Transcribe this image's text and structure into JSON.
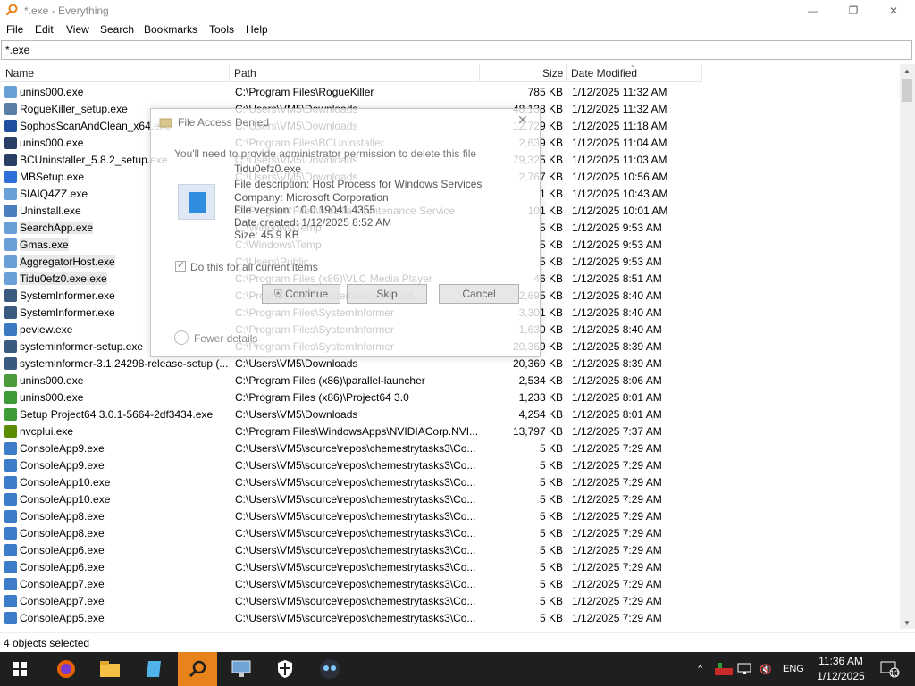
{
  "window": {
    "title": "*.exe - Everything",
    "minimize_label": "—",
    "maximize_label": "❐",
    "close_label": "✕"
  },
  "menu": [
    "File",
    "Edit",
    "View",
    "Search",
    "Bookmarks",
    "Tools",
    "Help"
  ],
  "search": {
    "value": "*.exe"
  },
  "columns": {
    "name": "Name",
    "path": "Path",
    "size": "Size",
    "date": "Date Modified"
  },
  "rows": [
    {
      "name": "unins000.exe",
      "path": "C:\\Program Files\\RogueKiller",
      "size": "785 KB",
      "date": "1/12/2025 11:32 AM",
      "icon": "generic-exe-icon",
      "color": "#6aa0d8"
    },
    {
      "name": "RogueKiller_setup.exe",
      "path": "C:\\Users\\VM5\\Downloads",
      "size": "48,138 KB",
      "date": "1/12/2025 11:32 AM",
      "icon": "roguekiller-icon",
      "color": "#5a7fa6"
    },
    {
      "name": "SophosScanAndClean_x64.exe",
      "path": "C:\\Users\\VM5\\Downloads",
      "size": "12,729 KB",
      "date": "1/12/2025 11:18 AM",
      "icon": "sophos-icon",
      "color": "#1f4e9e"
    },
    {
      "name": "unins000.exe",
      "path": "C:\\Program Files\\BCUninstaller",
      "size": "2,639 KB",
      "date": "1/12/2025 11:04 AM",
      "icon": "bcuninstaller-icon",
      "color": "#2a3f66"
    },
    {
      "name": "BCUninstaller_5.8.2_setup.exe",
      "path": "C:\\Users\\VM5\\Downloads",
      "size": "79,325 KB",
      "date": "1/12/2025 11:03 AM",
      "icon": "bcuninstaller-icon",
      "color": "#2a3f66"
    },
    {
      "name": "MBSetup.exe",
      "path": "C:\\Users\\VM5\\Downloads",
      "size": "2,767 KB",
      "date": "1/12/2025 10:56 AM",
      "icon": "malwarebytes-icon",
      "color": "#2d6fd6"
    },
    {
      "name": "SIAIQ4ZZ.exe",
      "path": "",
      "size": "1 KB",
      "date": "1/12/2025 10:43 AM",
      "icon": "generic-exe-icon",
      "color": "#6aa0d8"
    },
    {
      "name": "Uninstall.exe",
      "path": "C:\\Program Files\\Mozilla Maintenance Service",
      "size": "101 KB",
      "date": "1/12/2025 10:01 AM",
      "icon": "uninstall-icon",
      "color": "#4b7fbf"
    },
    {
      "name": "SearchApp.exe",
      "path": "C:\\Windows\\Temp",
      "size": "5 KB",
      "date": "1/12/2025 9:53 AM",
      "icon": "generic-exe-icon",
      "color": "#6aa0d8",
      "selected": true
    },
    {
      "name": "Gmas.exe",
      "path": "C:\\Windows\\Temp",
      "size": "5 KB",
      "date": "1/12/2025 9:53 AM",
      "icon": "generic-exe-icon",
      "color": "#6aa0d8",
      "selected": true
    },
    {
      "name": "AggregatorHost.exe",
      "path": "C:\\Users\\Public",
      "size": "5 KB",
      "date": "1/12/2025 9:53 AM",
      "icon": "generic-exe-icon",
      "color": "#6aa0d8",
      "selected": true
    },
    {
      "name": "Tidu0efz0.exe.exe",
      "path": "C:\\Program Files (x86)\\VLC Media Player",
      "size": "46 KB",
      "date": "1/12/2025 8:51 AM",
      "icon": "generic-exe-icon",
      "color": "#6aa0d8",
      "selected": true
    },
    {
      "name": "SystemInformer.exe",
      "path": "C:\\Program Files\\SystemInformer\\x86",
      "size": "2,695 KB",
      "date": "1/12/2025 8:40 AM",
      "icon": "systeminformer-icon",
      "color": "#3b5a80"
    },
    {
      "name": "SystemInformer.exe",
      "path": "C:\\Program Files\\SystemInformer",
      "size": "3,301 KB",
      "date": "1/12/2025 8:40 AM",
      "icon": "systeminformer-icon",
      "color": "#3b5a80"
    },
    {
      "name": "peview.exe",
      "path": "C:\\Program Files\\SystemInformer",
      "size": "1,630 KB",
      "date": "1/12/2025 8:40 AM",
      "icon": "peview-icon",
      "color": "#3a78c2"
    },
    {
      "name": "systeminformer-setup.exe",
      "path": "C:\\Program Files\\SystemInformer",
      "size": "20,369 KB",
      "date": "1/12/2025 8:39 AM",
      "icon": "systeminformer-icon",
      "color": "#3b5a80"
    },
    {
      "name": "systeminformer-3.1.24298-release-setup (...",
      "path": "C:\\Users\\VM5\\Downloads",
      "size": "20,369 KB",
      "date": "1/12/2025 8:39 AM",
      "icon": "systeminformer-icon",
      "color": "#3b5a80"
    },
    {
      "name": "unins000.exe",
      "path": "C:\\Program Files (x86)\\parallel-launcher",
      "size": "2,534 KB",
      "date": "1/12/2025 8:06 AM",
      "icon": "parallel-launcher-icon",
      "color": "#4c9a3a"
    },
    {
      "name": "unins000.exe",
      "path": "C:\\Program Files (x86)\\Project64 3.0",
      "size": "1,233 KB",
      "date": "1/12/2025 8:01 AM",
      "icon": "project64-icon",
      "color": "#3e9b35"
    },
    {
      "name": "Setup Project64 3.0.1-5664-2df3434.exe",
      "path": "C:\\Users\\VM5\\Downloads",
      "size": "4,254 KB",
      "date": "1/12/2025 8:01 AM",
      "icon": "project64-icon",
      "color": "#3e9b35"
    },
    {
      "name": "nvcplui.exe",
      "path": "C:\\Program Files\\WindowsApps\\NVIDIACorp.NVI...",
      "size": "13,797 KB",
      "date": "1/12/2025 7:37 AM",
      "icon": "nvidia-icon",
      "color": "#5c8c00"
    },
    {
      "name": "ConsoleApp9.exe",
      "path": "C:\\Users\\VM5\\source\\repos\\chemestrytasks3\\Co...",
      "size": "5 KB",
      "date": "1/12/2025 7:29 AM",
      "icon": "console-app-icon",
      "color": "#3d7cc9"
    },
    {
      "name": "ConsoleApp9.exe",
      "path": "C:\\Users\\VM5\\source\\repos\\chemestrytasks3\\Co...",
      "size": "5 KB",
      "date": "1/12/2025 7:29 AM",
      "icon": "console-app-icon",
      "color": "#3d7cc9"
    },
    {
      "name": "ConsoleApp10.exe",
      "path": "C:\\Users\\VM5\\source\\repos\\chemestrytasks3\\Co...",
      "size": "5 KB",
      "date": "1/12/2025 7:29 AM",
      "icon": "console-app-icon",
      "color": "#3d7cc9"
    },
    {
      "name": "ConsoleApp10.exe",
      "path": "C:\\Users\\VM5\\source\\repos\\chemestrytasks3\\Co...",
      "size": "5 KB",
      "date": "1/12/2025 7:29 AM",
      "icon": "console-app-icon",
      "color": "#3d7cc9"
    },
    {
      "name": "ConsoleApp8.exe",
      "path": "C:\\Users\\VM5\\source\\repos\\chemestrytasks3\\Co...",
      "size": "5 KB",
      "date": "1/12/2025 7:29 AM",
      "icon": "console-app-icon",
      "color": "#3d7cc9"
    },
    {
      "name": "ConsoleApp8.exe",
      "path": "C:\\Users\\VM5\\source\\repos\\chemestrytasks3\\Co...",
      "size": "5 KB",
      "date": "1/12/2025 7:29 AM",
      "icon": "console-app-icon",
      "color": "#3d7cc9"
    },
    {
      "name": "ConsoleApp6.exe",
      "path": "C:\\Users\\VM5\\source\\repos\\chemestrytasks3\\Co...",
      "size": "5 KB",
      "date": "1/12/2025 7:29 AM",
      "icon": "console-app-icon",
      "color": "#3d7cc9"
    },
    {
      "name": "ConsoleApp6.exe",
      "path": "C:\\Users\\VM5\\source\\repos\\chemestrytasks3\\Co...",
      "size": "5 KB",
      "date": "1/12/2025 7:29 AM",
      "icon": "console-app-icon",
      "color": "#3d7cc9"
    },
    {
      "name": "ConsoleApp7.exe",
      "path": "C:\\Users\\VM5\\source\\repos\\chemestrytasks3\\Co...",
      "size": "5 KB",
      "date": "1/12/2025 7:29 AM",
      "icon": "console-app-icon",
      "color": "#3d7cc9"
    },
    {
      "name": "ConsoleApp7.exe",
      "path": "C:\\Users\\VM5\\source\\repos\\chemestrytasks3\\Co...",
      "size": "5 KB",
      "date": "1/12/2025 7:29 AM",
      "icon": "console-app-icon",
      "color": "#3d7cc9"
    },
    {
      "name": "ConsoleApp5.exe",
      "path": "C:\\Users\\VM5\\source\\repos\\chemestrytasks3\\Co...",
      "size": "5 KB",
      "date": "1/12/2025 7:29 AM",
      "icon": "console-app-icon",
      "color": "#3d7cc9"
    }
  ],
  "status": {
    "text": "4 objects selected"
  },
  "dialog": {
    "title": "File Access Denied",
    "message": "You'll need to provide administrator permission to delete this file",
    "file_name": "Tidu0efz0.exe",
    "description": "File description: Host Process for Windows Services",
    "company": "Company: Microsoft Corporation",
    "version": "File version: 10.0.19041.4355",
    "created": "Date created: 1/12/2025 8:52 AM",
    "size": "Size: 45.9 KB",
    "checkbox_label": "Do this for all current items",
    "continue_label": "Continue",
    "skip_label": "Skip",
    "cancel_label": "Cancel",
    "fewer_label": "Fewer details"
  },
  "taskbar": {
    "items": [
      "windows-start-icon",
      "firefox-icon",
      "file-explorer-icon",
      "notepad-icon",
      "everything-search-icon",
      "network-monitor-icon",
      "security-shield-icon",
      "owl-app-icon"
    ],
    "language": "ENG",
    "time": "11:36 AM",
    "date": "1/12/2025",
    "notifications": "13"
  }
}
